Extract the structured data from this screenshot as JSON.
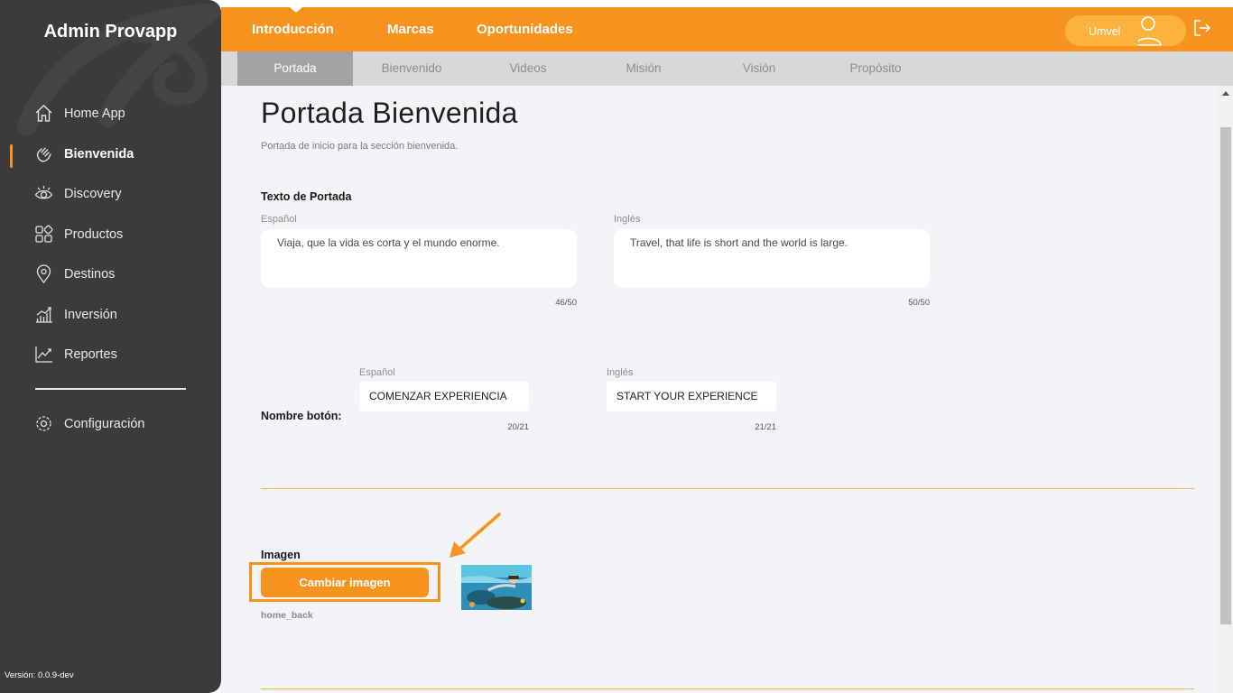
{
  "sidebar": {
    "brand": "Admin Provapp",
    "items": [
      {
        "label": "Home App",
        "icon": "home-icon"
      },
      {
        "label": "Bienvenida",
        "icon": "waving-hand-icon",
        "active": true
      },
      {
        "label": "Discovery",
        "icon": "eye-icon"
      },
      {
        "label": "Productos",
        "icon": "grid-icon"
      },
      {
        "label": "Destinos",
        "icon": "location-pin-icon"
      },
      {
        "label": "Inversión",
        "icon": "bar-chart-icon"
      },
      {
        "label": "Reportes",
        "icon": "line-chart-icon"
      }
    ],
    "settings": {
      "label": "Configuración",
      "icon": "gear-icon"
    },
    "version": "Versión: 0.0.9-dev"
  },
  "topbar": {
    "tabs": [
      {
        "label": "Introducción",
        "active": true
      },
      {
        "label": "Marcas"
      },
      {
        "label": "Oportunidades"
      }
    ],
    "user": {
      "name": "Umvel",
      "icon": "user-avatar-icon"
    },
    "logout_icon": "logout-icon",
    "color": "#f7931e"
  },
  "subtabs": [
    {
      "label": "Portada",
      "active": true
    },
    {
      "label": "Bienvenido"
    },
    {
      "label": "Videos"
    },
    {
      "label": "Misión"
    },
    {
      "label": "Visión"
    },
    {
      "label": "Propósito"
    }
  ],
  "main": {
    "title": "Portada Bienvenida",
    "subtitle": "Portada de inicio para la sección bienvenida.",
    "cover_text": {
      "section_label": "Texto de Portada",
      "es": {
        "label": "Español",
        "value": "Viaja, que la vida es corta y el mundo enorme.",
        "counter": "46/50"
      },
      "en": {
        "label": "Inglés",
        "value": "Travel, that life is short and the world is large.",
        "counter": "50/50"
      }
    },
    "button_name": {
      "section_label": "Nombre botón:",
      "es": {
        "label": "Español",
        "value": "COMENZAR EXPERIENCIA",
        "counter": "20/21"
      },
      "en": {
        "label": "Inglés",
        "value": "START YOUR EXPERIENCE",
        "counter": "21/21"
      }
    },
    "image": {
      "section_label": "Imagen",
      "button_label": "Cambiar imagen",
      "filename": "home_back"
    }
  }
}
